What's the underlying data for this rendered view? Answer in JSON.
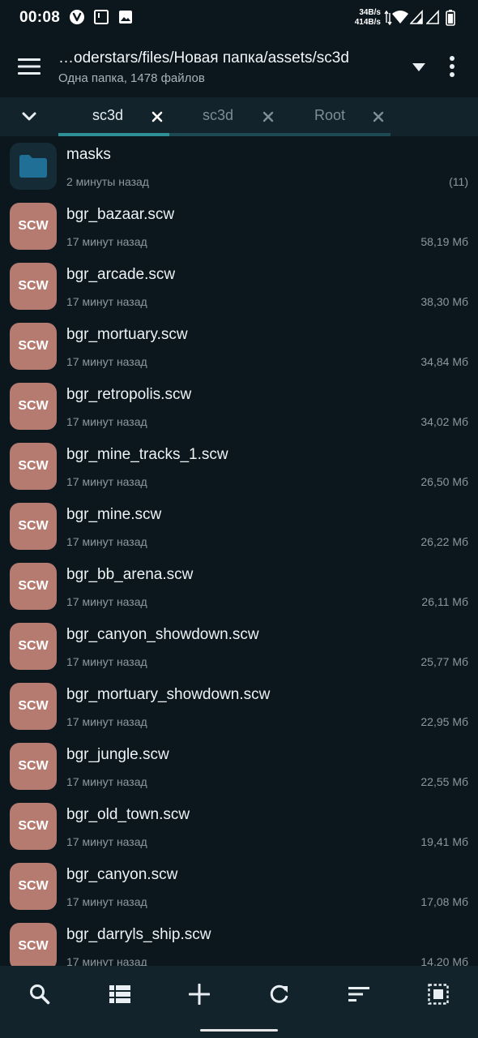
{
  "status_bar": {
    "time": "00:08",
    "speed_up": "34B/s",
    "speed_down": "414B/s"
  },
  "app_bar": {
    "path": "…oderstars/files/Новая папка/assets/sc3d",
    "summary": "Одна папка, 1478 файлов"
  },
  "tabs": [
    {
      "label": "sc3d",
      "active": true
    },
    {
      "label": "sc3d",
      "active": false
    },
    {
      "label": "Root",
      "active": false
    }
  ],
  "files": [
    {
      "name": "masks",
      "type": "folder",
      "time": "2 минуты назад",
      "info": "(11)"
    },
    {
      "name": "bgr_bazaar.scw",
      "type": "scw",
      "badge": "SCW",
      "time": "17 минут назад",
      "info": "58,19 Мб"
    },
    {
      "name": "bgr_arcade.scw",
      "type": "scw",
      "badge": "SCW",
      "time": "17 минут назад",
      "info": "38,30 Мб"
    },
    {
      "name": "bgr_mortuary.scw",
      "type": "scw",
      "badge": "SCW",
      "time": "17 минут назад",
      "info": "34,84 Мб"
    },
    {
      "name": "bgr_retropolis.scw",
      "type": "scw",
      "badge": "SCW",
      "time": "17 минут назад",
      "info": "34,02 Мб"
    },
    {
      "name": "bgr_mine_tracks_1.scw",
      "type": "scw",
      "badge": "SCW",
      "time": "17 минут назад",
      "info": "26,50 Мб"
    },
    {
      "name": "bgr_mine.scw",
      "type": "scw",
      "badge": "SCW",
      "time": "17 минут назад",
      "info": "26,22 Мб"
    },
    {
      "name": "bgr_bb_arena.scw",
      "type": "scw",
      "badge": "SCW",
      "time": "17 минут назад",
      "info": "26,11 Мб"
    },
    {
      "name": "bgr_canyon_showdown.scw",
      "type": "scw",
      "badge": "SCW",
      "time": "17 минут назад",
      "info": "25,77 Мб"
    },
    {
      "name": "bgr_mortuary_showdown.scw",
      "type": "scw",
      "badge": "SCW",
      "time": "17 минут назад",
      "info": "22,95 Мб"
    },
    {
      "name": "bgr_jungle.scw",
      "type": "scw",
      "badge": "SCW",
      "time": "17 минут назад",
      "info": "22,55 Мб"
    },
    {
      "name": "bgr_old_town.scw",
      "type": "scw",
      "badge": "SCW",
      "time": "17 минут назад",
      "info": "19,41 Мб"
    },
    {
      "name": "bgr_canyon.scw",
      "type": "scw",
      "badge": "SCW",
      "time": "17 минут назад",
      "info": "17,08 Мб"
    },
    {
      "name": "bgr_darryls_ship.scw",
      "type": "scw",
      "badge": "SCW",
      "time": "17 минут назад",
      "info": "14,20 Мб"
    }
  ],
  "toolbar": [
    {
      "icon": "search-icon"
    },
    {
      "icon": "view-list-icon"
    },
    {
      "icon": "add-icon"
    },
    {
      "icon": "refresh-icon"
    },
    {
      "icon": "sort-icon"
    },
    {
      "icon": "select-all-icon"
    }
  ],
  "colors": {
    "background": "#0b161d",
    "bar": "#12232c",
    "accent": "#2f8f96",
    "scw_badge": "#b67b70",
    "folder": "#1f6f96"
  }
}
